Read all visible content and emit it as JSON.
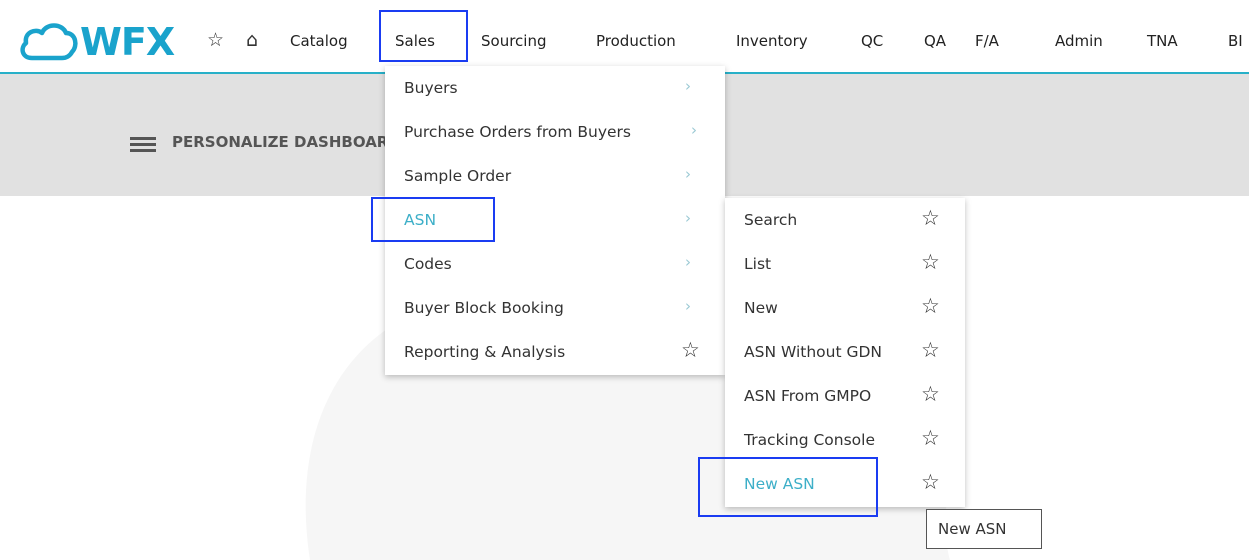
{
  "brand": {
    "logo_text": "WFX",
    "logo_color": "#1aa3cc",
    "accent": "#27b0c8"
  },
  "nav": {
    "icons": [
      "star-icon",
      "home-icon"
    ],
    "items": [
      "Catalog",
      "Sales",
      "Sourcing",
      "Production",
      "Inventory",
      "QC",
      "QA",
      "F/A",
      "Admin",
      "TNA",
      "BI"
    ]
  },
  "dashboard": {
    "personalize_label": "PERSONALIZE DASHBOARD"
  },
  "sales_menu": {
    "items": [
      {
        "label": "Buyers"
      },
      {
        "label": "Purchase Orders from Buyers"
      },
      {
        "label": "Sample Order"
      },
      {
        "label": "ASN"
      },
      {
        "label": "Codes"
      },
      {
        "label": "Buyer Block Booking"
      },
      {
        "label": "Reporting & Analysis"
      }
    ]
  },
  "asn_submenu": {
    "items": [
      {
        "label": "Search"
      },
      {
        "label": "List"
      },
      {
        "label": "New"
      },
      {
        "label": "ASN Without GDN"
      },
      {
        "label": "ASN From GMPO"
      },
      {
        "label": "Tracking Console"
      },
      {
        "label": "New ASN"
      }
    ]
  },
  "tooltip": {
    "text": "New ASN"
  },
  "colors": {
    "highlight_box": "#1a3cf2",
    "active_item": "#3dafc8",
    "band": "#e1e1e1"
  }
}
